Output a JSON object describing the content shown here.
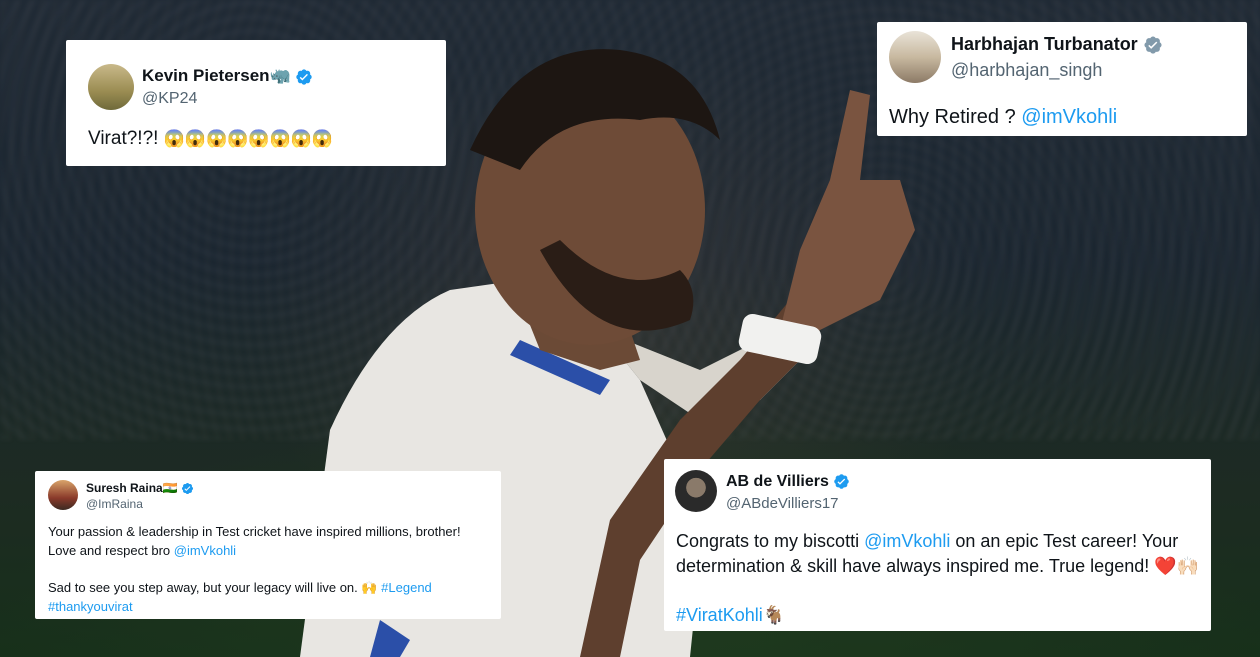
{
  "tweets": {
    "kp": {
      "name": "Kevin Pietersen",
      "name_emoji": "🦏",
      "handle": "@KP24",
      "text": "Virat?!?! ",
      "emojis": "😱😱😱😱😱😱😱😱"
    },
    "harbhajan": {
      "name": "Harbhajan Turbanator",
      "handle": "@harbhajan_singh",
      "text": "Why Retired ? ",
      "mention": "@imVkohli"
    },
    "raina": {
      "name": "Suresh Raina",
      "name_emoji": "🇮🇳",
      "handle": "@ImRaina",
      "line1": "Your passion & leadership in Test cricket have inspired millions, brother!",
      "line2": "Love and respect bro ",
      "line2_mention": "@imVkohli",
      "line3": "Sad to see you step away, but your legacy will live on. 🙌 ",
      "line3_hashtag": "#Legend",
      "line4_hashtag": "#thankyouvirat"
    },
    "ab": {
      "name": "AB de Villiers",
      "handle": "@ABdeVilliers17",
      "line1_a": "Congrats to my biscotti ",
      "line1_mention": "@imVkohli",
      "line1_b": " on an epic Test career! Your",
      "line2": "determination & skill have always inspired me. True legend! ❤️🙌🏻",
      "hashtag": "#ViratKohli",
      "hashtag_emoji": "🐐"
    }
  },
  "colors": {
    "link": "#1d9bf0",
    "verified": "#1d9bf0"
  },
  "icons": [
    "verified-badge-icon"
  ]
}
